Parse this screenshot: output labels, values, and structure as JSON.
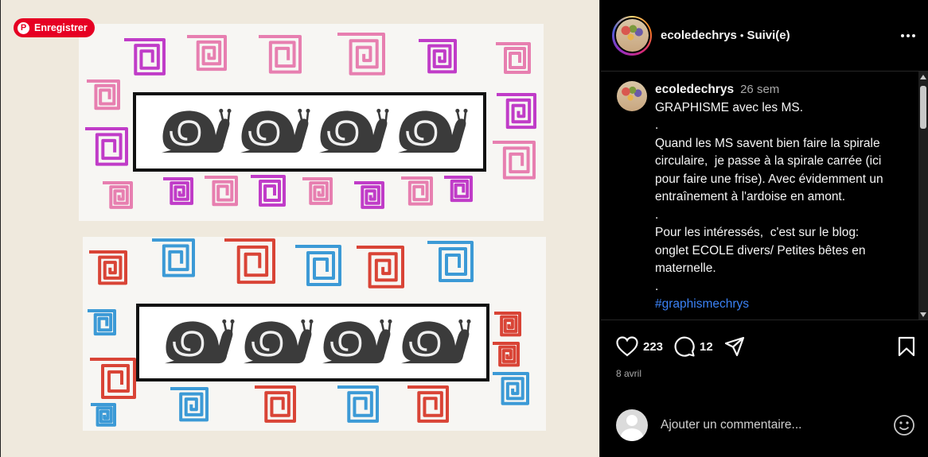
{
  "pinterest": {
    "save_label": "Enregistrer",
    "logo": "P"
  },
  "header": {
    "username": "ecoledechrys",
    "separator": "•",
    "follow_label": "Suivi(e)"
  },
  "caption": {
    "username": "ecoledechrys",
    "time": "26 sem",
    "body": "GRAPHISME avec les MS.\n.\nQuand les MS savent bien faire la spirale circulaire,  je passe à la spirale carrée (ici pour faire une frise). Avec évidemment un entraînement à l'ardoise en amont.\n.\nPour les intéressés,  c'est sur le blog: onglet ECOLE divers/ Petites bêtes en maternelle.\n.",
    "hashtag": "#graphismechrys"
  },
  "actions": {
    "likes": "223",
    "comments": "12"
  },
  "date": "8 avril",
  "comment": {
    "placeholder": "Ajouter un commentaire..."
  },
  "colors": {
    "pinterest_red": "#e60023",
    "hashtag_blue": "#3b82f6",
    "magenta": "#c03cc8",
    "pink": "#e77fb0",
    "red": "#d94436",
    "blue": "#3c9ad6"
  },
  "icons": [
    "pinterest-icon",
    "more-icon",
    "heart-icon",
    "comment-icon",
    "share-icon",
    "bookmark-icon",
    "emoji-icon",
    "snail-icon"
  ]
}
